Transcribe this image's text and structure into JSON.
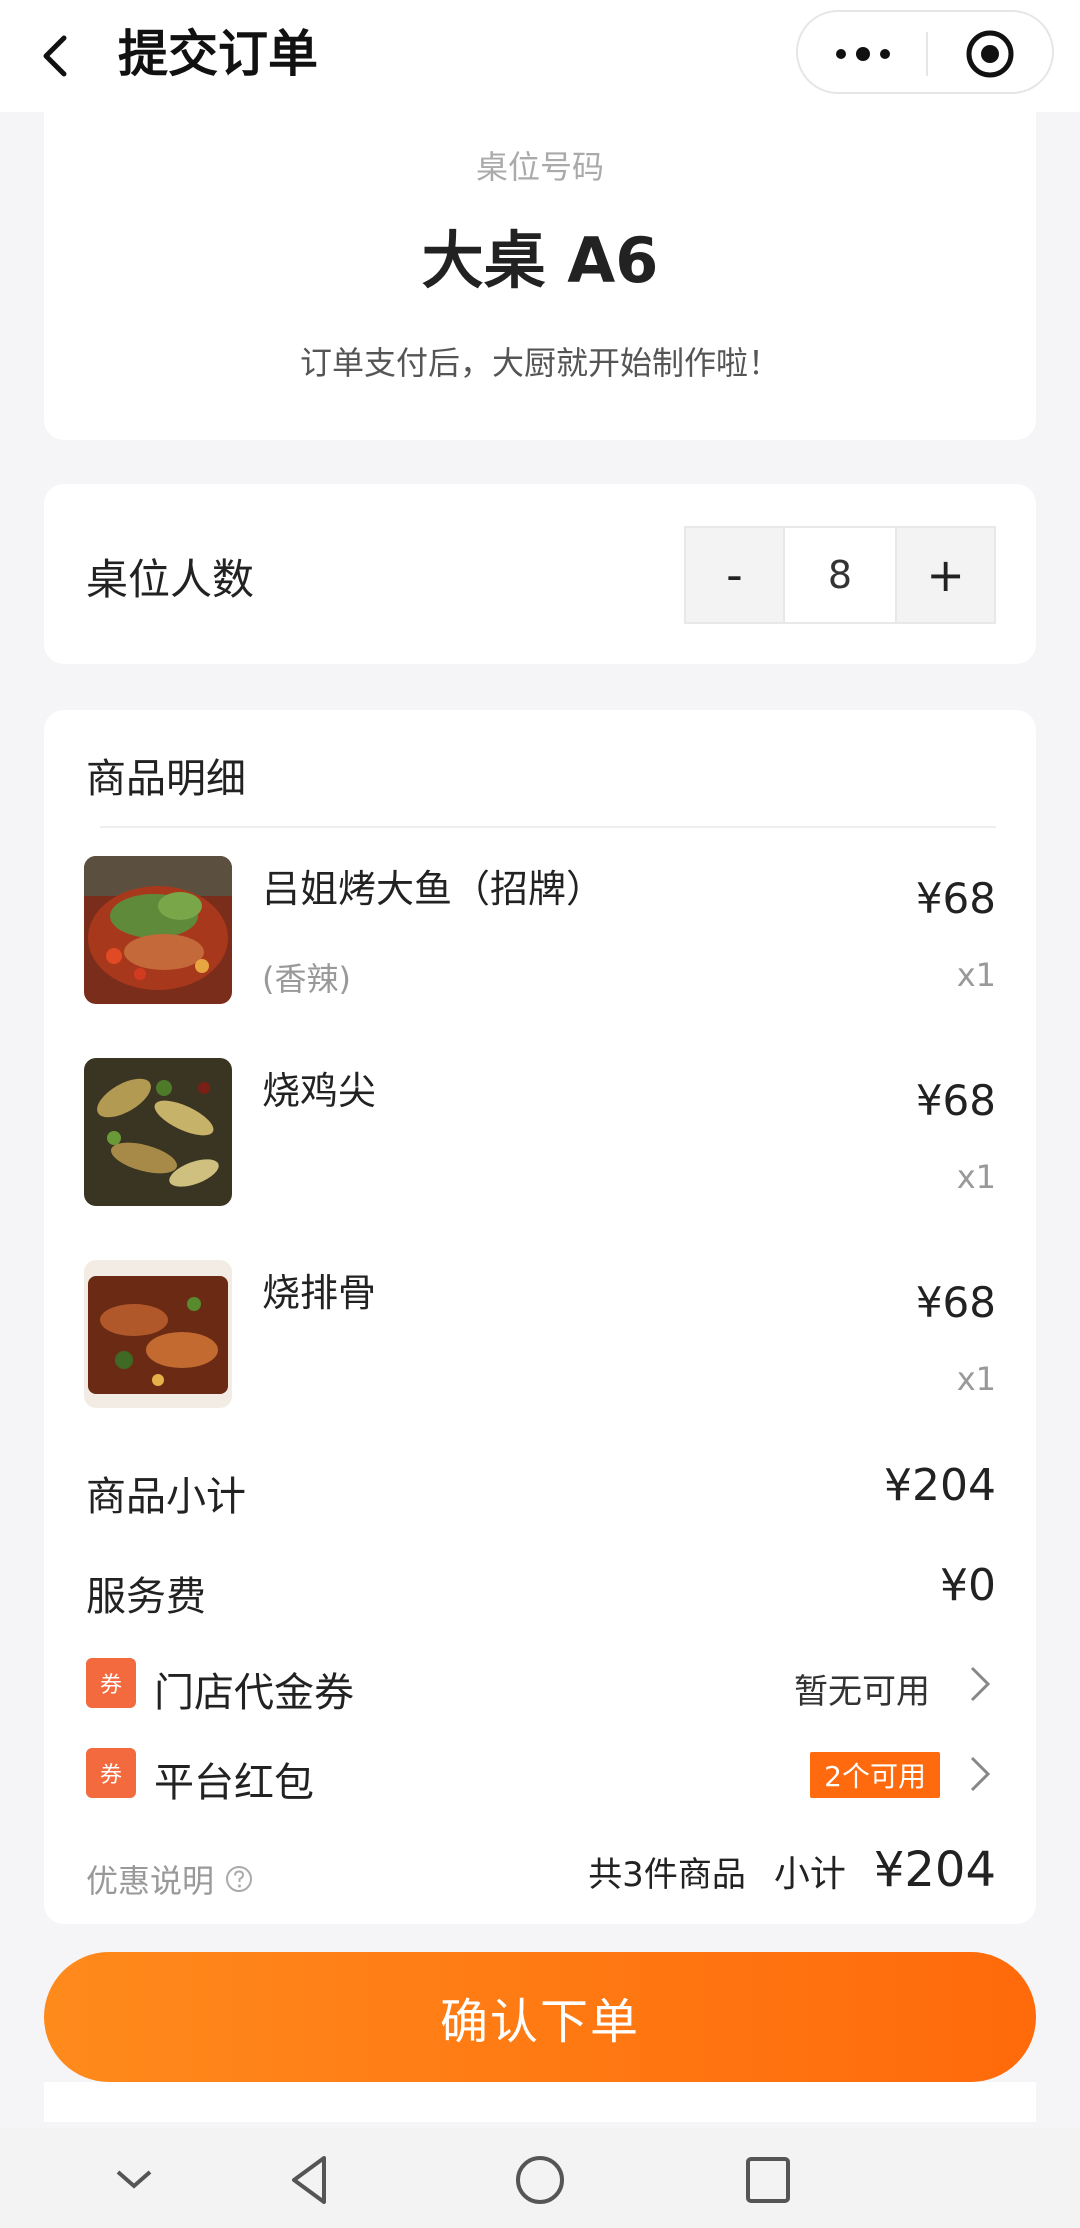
{
  "header": {
    "title": "提交订单"
  },
  "table": {
    "label": "桌位号码",
    "name": "大桌 A6",
    "tip": "订单支付后，大厨就开始制作啦！"
  },
  "people": {
    "label": "桌位人数",
    "minus": "-",
    "value": "8",
    "plus": "+"
  },
  "items": {
    "heading": "商品明细",
    "list": [
      {
        "name": "吕姐烤大鱼（招牌）",
        "spec": "(香辣)",
        "price": "¥68",
        "qty": "x1"
      },
      {
        "name": "烧鸡尖",
        "spec": "",
        "price": "¥68",
        "qty": "x1"
      },
      {
        "name": "烧排骨",
        "spec": "",
        "price": "¥68",
        "qty": "x1"
      }
    ]
  },
  "subtotal": {
    "label": "商品小计",
    "value": "¥204"
  },
  "service_fee": {
    "label": "服务费",
    "value": "¥0"
  },
  "coupons": {
    "badge": "券",
    "store": {
      "label": "门店代金券",
      "status": "暂无可用"
    },
    "platform": {
      "label": "平台红包",
      "status": "2个可用"
    }
  },
  "summary": {
    "promo_note": "优惠说明",
    "count": "共3件商品",
    "total_label": "小计",
    "total": "¥204"
  },
  "confirm_label": "确认下单",
  "colors": {
    "accent": "#ff6a0e",
    "badge": "#f26a3d"
  }
}
